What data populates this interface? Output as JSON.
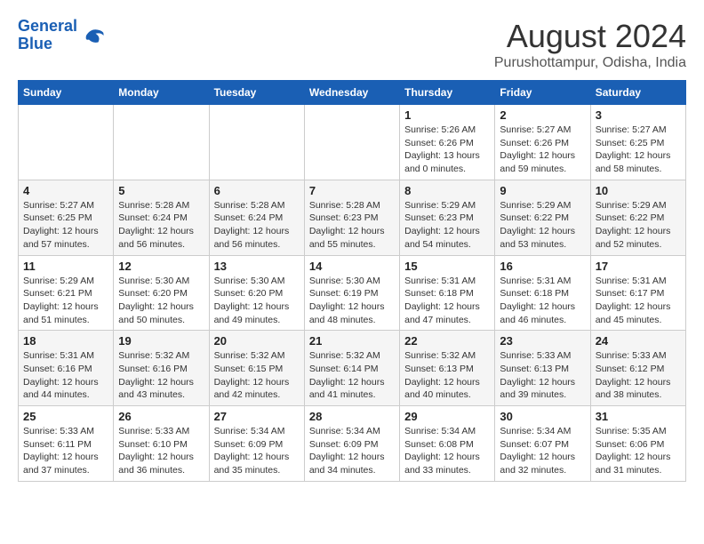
{
  "header": {
    "logo_line1": "General",
    "logo_line2": "Blue",
    "month": "August 2024",
    "location": "Purushottampur, Odisha, India"
  },
  "weekdays": [
    "Sunday",
    "Monday",
    "Tuesday",
    "Wednesday",
    "Thursday",
    "Friday",
    "Saturday"
  ],
  "weeks": [
    [
      {
        "day": "",
        "info": ""
      },
      {
        "day": "",
        "info": ""
      },
      {
        "day": "",
        "info": ""
      },
      {
        "day": "",
        "info": ""
      },
      {
        "day": "1",
        "info": "Sunrise: 5:26 AM\nSunset: 6:26 PM\nDaylight: 13 hours\nand 0 minutes."
      },
      {
        "day": "2",
        "info": "Sunrise: 5:27 AM\nSunset: 6:26 PM\nDaylight: 12 hours\nand 59 minutes."
      },
      {
        "day": "3",
        "info": "Sunrise: 5:27 AM\nSunset: 6:25 PM\nDaylight: 12 hours\nand 58 minutes."
      }
    ],
    [
      {
        "day": "4",
        "info": "Sunrise: 5:27 AM\nSunset: 6:25 PM\nDaylight: 12 hours\nand 57 minutes."
      },
      {
        "day": "5",
        "info": "Sunrise: 5:28 AM\nSunset: 6:24 PM\nDaylight: 12 hours\nand 56 minutes."
      },
      {
        "day": "6",
        "info": "Sunrise: 5:28 AM\nSunset: 6:24 PM\nDaylight: 12 hours\nand 56 minutes."
      },
      {
        "day": "7",
        "info": "Sunrise: 5:28 AM\nSunset: 6:23 PM\nDaylight: 12 hours\nand 55 minutes."
      },
      {
        "day": "8",
        "info": "Sunrise: 5:29 AM\nSunset: 6:23 PM\nDaylight: 12 hours\nand 54 minutes."
      },
      {
        "day": "9",
        "info": "Sunrise: 5:29 AM\nSunset: 6:22 PM\nDaylight: 12 hours\nand 53 minutes."
      },
      {
        "day": "10",
        "info": "Sunrise: 5:29 AM\nSunset: 6:22 PM\nDaylight: 12 hours\nand 52 minutes."
      }
    ],
    [
      {
        "day": "11",
        "info": "Sunrise: 5:29 AM\nSunset: 6:21 PM\nDaylight: 12 hours\nand 51 minutes."
      },
      {
        "day": "12",
        "info": "Sunrise: 5:30 AM\nSunset: 6:20 PM\nDaylight: 12 hours\nand 50 minutes."
      },
      {
        "day": "13",
        "info": "Sunrise: 5:30 AM\nSunset: 6:20 PM\nDaylight: 12 hours\nand 49 minutes."
      },
      {
        "day": "14",
        "info": "Sunrise: 5:30 AM\nSunset: 6:19 PM\nDaylight: 12 hours\nand 48 minutes."
      },
      {
        "day": "15",
        "info": "Sunrise: 5:31 AM\nSunset: 6:18 PM\nDaylight: 12 hours\nand 47 minutes."
      },
      {
        "day": "16",
        "info": "Sunrise: 5:31 AM\nSunset: 6:18 PM\nDaylight: 12 hours\nand 46 minutes."
      },
      {
        "day": "17",
        "info": "Sunrise: 5:31 AM\nSunset: 6:17 PM\nDaylight: 12 hours\nand 45 minutes."
      }
    ],
    [
      {
        "day": "18",
        "info": "Sunrise: 5:31 AM\nSunset: 6:16 PM\nDaylight: 12 hours\nand 44 minutes."
      },
      {
        "day": "19",
        "info": "Sunrise: 5:32 AM\nSunset: 6:16 PM\nDaylight: 12 hours\nand 43 minutes."
      },
      {
        "day": "20",
        "info": "Sunrise: 5:32 AM\nSunset: 6:15 PM\nDaylight: 12 hours\nand 42 minutes."
      },
      {
        "day": "21",
        "info": "Sunrise: 5:32 AM\nSunset: 6:14 PM\nDaylight: 12 hours\nand 41 minutes."
      },
      {
        "day": "22",
        "info": "Sunrise: 5:32 AM\nSunset: 6:13 PM\nDaylight: 12 hours\nand 40 minutes."
      },
      {
        "day": "23",
        "info": "Sunrise: 5:33 AM\nSunset: 6:13 PM\nDaylight: 12 hours\nand 39 minutes."
      },
      {
        "day": "24",
        "info": "Sunrise: 5:33 AM\nSunset: 6:12 PM\nDaylight: 12 hours\nand 38 minutes."
      }
    ],
    [
      {
        "day": "25",
        "info": "Sunrise: 5:33 AM\nSunset: 6:11 PM\nDaylight: 12 hours\nand 37 minutes."
      },
      {
        "day": "26",
        "info": "Sunrise: 5:33 AM\nSunset: 6:10 PM\nDaylight: 12 hours\nand 36 minutes."
      },
      {
        "day": "27",
        "info": "Sunrise: 5:34 AM\nSunset: 6:09 PM\nDaylight: 12 hours\nand 35 minutes."
      },
      {
        "day": "28",
        "info": "Sunrise: 5:34 AM\nSunset: 6:09 PM\nDaylight: 12 hours\nand 34 minutes."
      },
      {
        "day": "29",
        "info": "Sunrise: 5:34 AM\nSunset: 6:08 PM\nDaylight: 12 hours\nand 33 minutes."
      },
      {
        "day": "30",
        "info": "Sunrise: 5:34 AM\nSunset: 6:07 PM\nDaylight: 12 hours\nand 32 minutes."
      },
      {
        "day": "31",
        "info": "Sunrise: 5:35 AM\nSunset: 6:06 PM\nDaylight: 12 hours\nand 31 minutes."
      }
    ]
  ]
}
